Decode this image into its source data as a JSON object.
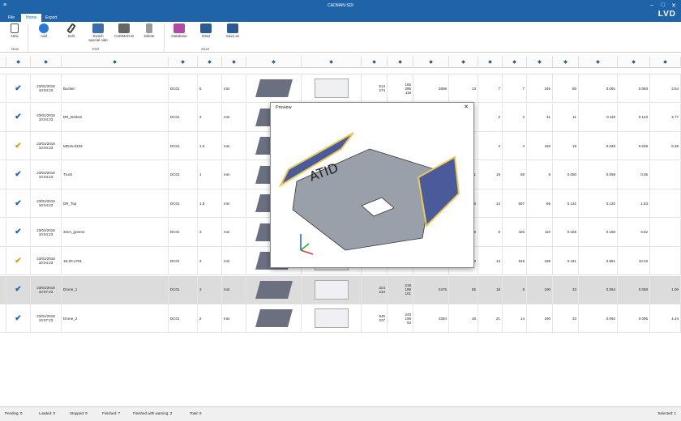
{
  "title": "CADMAN-SDI",
  "brand": "LVD",
  "window_controls": {
    "minimize": "–",
    "maximize": "□",
    "close": "✕"
  },
  "tabs": [
    {
      "label": "File"
    },
    {
      "label": "Home"
    },
    {
      "label": "Export"
    }
  ],
  "ribbon": {
    "buttons": [
      {
        "label": "New",
        "icon": "new-document-icon"
      },
      {
        "label": "Add",
        "icon": "add-icon"
      },
      {
        "label": "Edit",
        "icon": "edit-icon"
      },
      {
        "label": "Switch\nspecial side",
        "icon": "switch-side-icon"
      },
      {
        "label": "CADMAN-B",
        "icon": "printer-icon"
      },
      {
        "label": "Delete",
        "icon": "delete-icon"
      },
      {
        "label": "Database",
        "icon": "database-icon"
      },
      {
        "label": "DSM",
        "icon": "save-icon"
      },
      {
        "label": "Save as",
        "icon": "save-as-icon"
      }
    ],
    "groups": [
      {
        "label": "New"
      },
      {
        "label": "Part"
      },
      {
        "label": "Save"
      }
    ]
  },
  "columns": [
    "status-icon",
    "date-icon",
    "name-icon",
    "material-icon",
    "thickness-icon",
    "unit-icon",
    "3d-icon",
    "flat-icon",
    "dim-icon",
    "weight-icon",
    "count-icon",
    "bend-icon",
    "tool-icon",
    "punch-icon",
    "die-icon",
    "length-icon",
    "area-icon",
    "cost-icon",
    "time-icon",
    "price-icon"
  ],
  "rows": [
    {
      "date": "23/01/2018",
      "time": "10:04:23",
      "name": "Bucket",
      "mat": "DC01",
      "thk": "5",
      "unit": "mm",
      "d1": "514",
      "d2": "274",
      "d3": "165",
      "d4": "295",
      "d5": "118",
      "w": "2698",
      "c": "13",
      "b": "7",
      "t": "7",
      "p": "245",
      "q": "80",
      "l": "0.091",
      "a": "0.093",
      "x": "3.54",
      "warn": false
    },
    {
      "date": "23/01/2018",
      "time": "10:04:23",
      "name": "DR_Bottom",
      "mat": "DC01",
      "thk": "3",
      "unit": "mm",
      "d1": "",
      "d2": "",
      "d3": "",
      "d4": "",
      "d5": "",
      "w": "",
      "c": "",
      "b": "2",
      "t": "2",
      "p": "41",
      "q": "11",
      "l": "0.118",
      "a": "0.123",
      "x": "2.77",
      "warn": false
    },
    {
      "date": "23/01/2018",
      "time": "10:04:23",
      "name": "MD15-0333",
      "mat": "DC01",
      "thk": "1.5",
      "unit": "mm",
      "d1": "",
      "d2": "",
      "d3": "",
      "d4": "",
      "d5": "",
      "w": "",
      "c": "",
      "b": "4",
      "t": "4",
      "p": "150",
      "q": "19",
      "l": "0.049",
      "a": "0.049",
      "x": "0.38",
      "warn": true
    },
    {
      "date": "23/01/2018",
      "time": "10:04:23",
      "name": "Truck",
      "mat": "DC01",
      "thk": "1",
      "unit": "mm",
      "d1": "",
      "d2": "",
      "d3": "",
      "d4": "",
      "d5": "",
      "w": "",
      "c": "21",
      "b": "19",
      "t": "58",
      "p": "8",
      "q": "0.050",
      "l": "0.059",
      "a": "0.36",
      "x": "",
      "warn": false
    },
    {
      "date": "23/01/2018",
      "time": "10:04:23",
      "name": "DR_Top",
      "mat": "DC01",
      "thk": "1.5",
      "unit": "mm",
      "d1": "",
      "d2": "",
      "d3": "",
      "d4": "",
      "d5": "",
      "w": "",
      "c": "18",
      "b": "14",
      "t": "507",
      "p": "66",
      "q": "0.131",
      "l": "0.132",
      "a": "1.53",
      "x": "",
      "warn": false
    },
    {
      "date": "23/01/2018",
      "time": "10:04:23",
      "name": "3mm_greene",
      "mat": "DC01",
      "thk": "3",
      "unit": "mm",
      "d1": "",
      "d2": "",
      "d3": "",
      "d4": "",
      "d5": "",
      "w": "",
      "c": "9",
      "b": "8",
      "t": "425",
      "p": "110",
      "q": "0.155",
      "l": "0.158",
      "a": "3.62",
      "x": "",
      "warn": false
    },
    {
      "date": "23/01/2018",
      "time": "10:04:23",
      "name": "18-20-1761",
      "mat": "DC01",
      "thk": "3",
      "unit": "mm",
      "d1": "",
      "d2": "",
      "d3": "",
      "d4": "",
      "d5": "15",
      "w": "",
      "c": "13",
      "b": "13",
      "t": "915",
      "p": "238",
      "q": "0.441",
      "l": "0.851",
      "a": "10.33",
      "x": "",
      "warn": true
    },
    {
      "date": "23/01/2018",
      "time": "10:07:23",
      "name": "Drone_1",
      "mat": "DC01",
      "thk": "2",
      "unit": "mm",
      "d1": "324",
      "d2": "244",
      "d3": "218",
      "d4": "198",
      "d5": "101",
      "w": "2475",
      "c": "65",
      "b": "18",
      "t": "8",
      "p": "190",
      "q": "33",
      "l": "0.064",
      "a": "0.068",
      "x": "1.00",
      "warn": false
    },
    {
      "date": "23/01/2018",
      "time": "10:07:23",
      "name": "Drone_2",
      "mat": "DC01",
      "thk": "2",
      "unit": "mm",
      "d1": "545",
      "d2": "237",
      "d3": "240",
      "d4": "198",
      "d5": "53",
      "w": "3354",
      "c": "48",
      "b": "21",
      "t": "14",
      "p": "190",
      "q": "33",
      "l": "0.092",
      "a": "0.095",
      "x": "1.44",
      "warn": false
    }
  ],
  "preview": {
    "title": "Preview",
    "close": "✕",
    "engraving": "ATID"
  },
  "status": {
    "pending": "Pending: 0",
    "loaded": "Loaded: 0",
    "stopped": "Stopped: 0",
    "finished": "Finished: 7",
    "warning": "Finished with warning: 2",
    "total": "Total: 9",
    "selected": "Selected: 1"
  },
  "colors": {
    "accent": "#1f63a9",
    "part_fill": "#4a5a9a",
    "part_edge": "#e8c95a"
  }
}
